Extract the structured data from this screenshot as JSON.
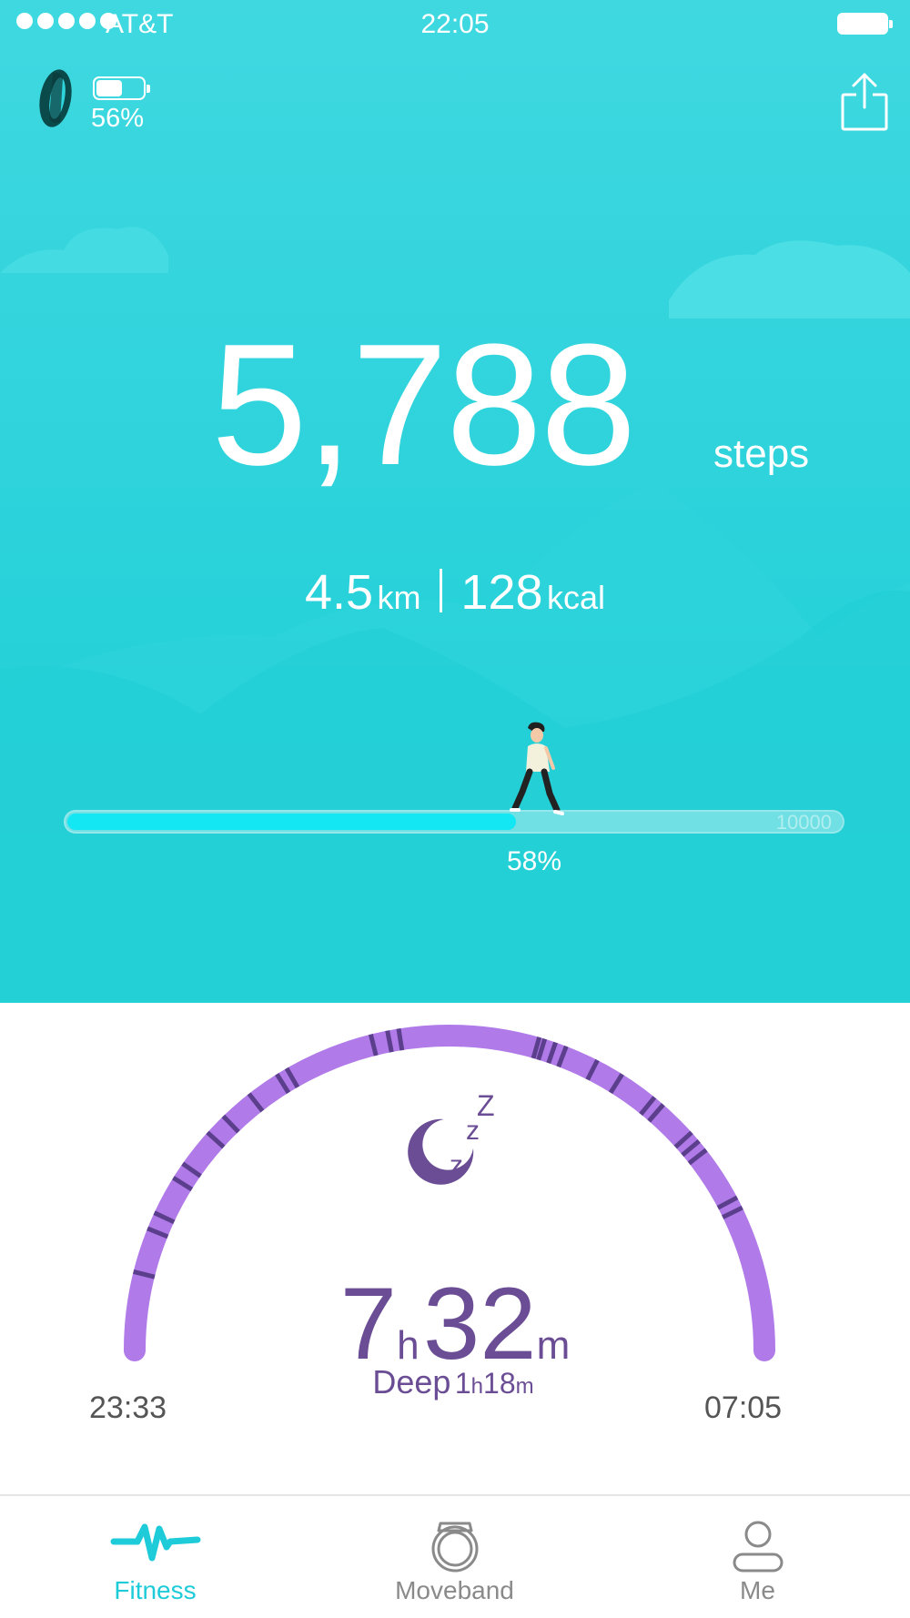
{
  "status_bar": {
    "carrier": "AT&T",
    "time": "22:05"
  },
  "header": {
    "device_battery_text": "56%",
    "device_battery_level": 0.56,
    "device_icon": "fitness-band-icon",
    "share_icon": "share-icon"
  },
  "steps": {
    "value": "5,788",
    "unit": "steps"
  },
  "distance": {
    "value": "4.5",
    "unit": "km"
  },
  "calories": {
    "value": "128",
    "unit": "kcal"
  },
  "progress": {
    "goal": "10000",
    "percent_text": "58%",
    "fraction": 0.58
  },
  "sleep": {
    "hours": "7",
    "hours_unit": "h",
    "minutes": "32",
    "minutes_unit": "m",
    "deep_label": "Deep",
    "deep_hours": "1",
    "deep_hours_unit": "h",
    "deep_minutes": "18",
    "deep_minutes_unit": "m",
    "start_time": "23:33",
    "end_time": "07:05",
    "icon": "moon-sleep-icon",
    "colors": {
      "arc": "#b07ae8",
      "deep_marks": "#5b3f8c",
      "text": "#6a4d94"
    }
  },
  "tabs": [
    {
      "label": "Fitness",
      "icon": "pulse-icon",
      "active": true
    },
    {
      "label": "Moveband",
      "icon": "band-icon",
      "active": false
    },
    {
      "label": "Me",
      "icon": "user-icon",
      "active": false
    }
  ],
  "colors": {
    "accent": "#1ecbd8",
    "progress_fill": "#12e7f3"
  }
}
